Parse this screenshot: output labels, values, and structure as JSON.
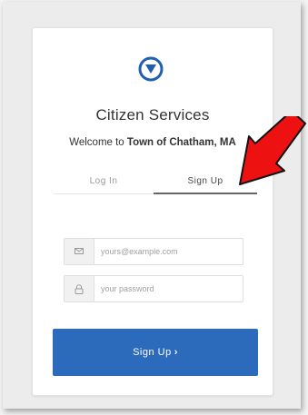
{
  "app": {
    "title": "Citizen Services",
    "welcome_prefix": "Welcome to ",
    "org_name": "Town of Chatham, MA",
    "brand_color": "#2c6bbb",
    "logo_icon": "arrow-circle-logo-icon"
  },
  "tabs": [
    {
      "label": "Log In",
      "active": false
    },
    {
      "label": "Sign Up",
      "active": true
    }
  ],
  "form": {
    "email": {
      "placeholder": "yours@example.com",
      "value": "",
      "icon": "envelope-icon"
    },
    "password": {
      "placeholder": "your password",
      "value": "",
      "icon": "lock-icon"
    },
    "submit_label": "Sign Up",
    "submit_chevron": "›"
  },
  "annotation": {
    "icon": "red-arrow-icon",
    "color": "#ee1111"
  }
}
